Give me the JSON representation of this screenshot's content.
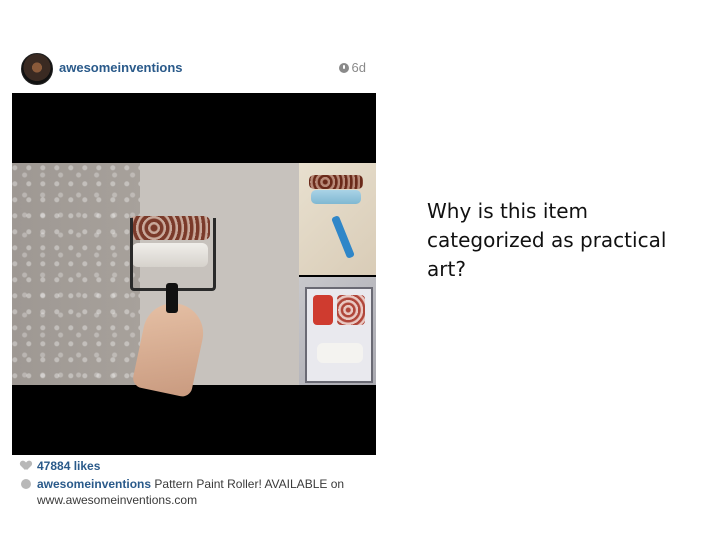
{
  "post": {
    "username": "awesomeinventions",
    "time": "6d",
    "likes": "47884 likes",
    "caption_user": "awesomeinventions",
    "caption_text": "Pattern Paint Roller! AVAILABLE on www.awesomeinventions.com"
  },
  "slide": {
    "question": "Why is this item categorized as practical art?"
  },
  "icons": {
    "time": "clock-icon",
    "likes": "heart-icon",
    "comment": "comment-icon"
  },
  "colors": {
    "username": "#2a5a8a",
    "meta": "#8a8a8a",
    "media_bg": "#000000"
  }
}
